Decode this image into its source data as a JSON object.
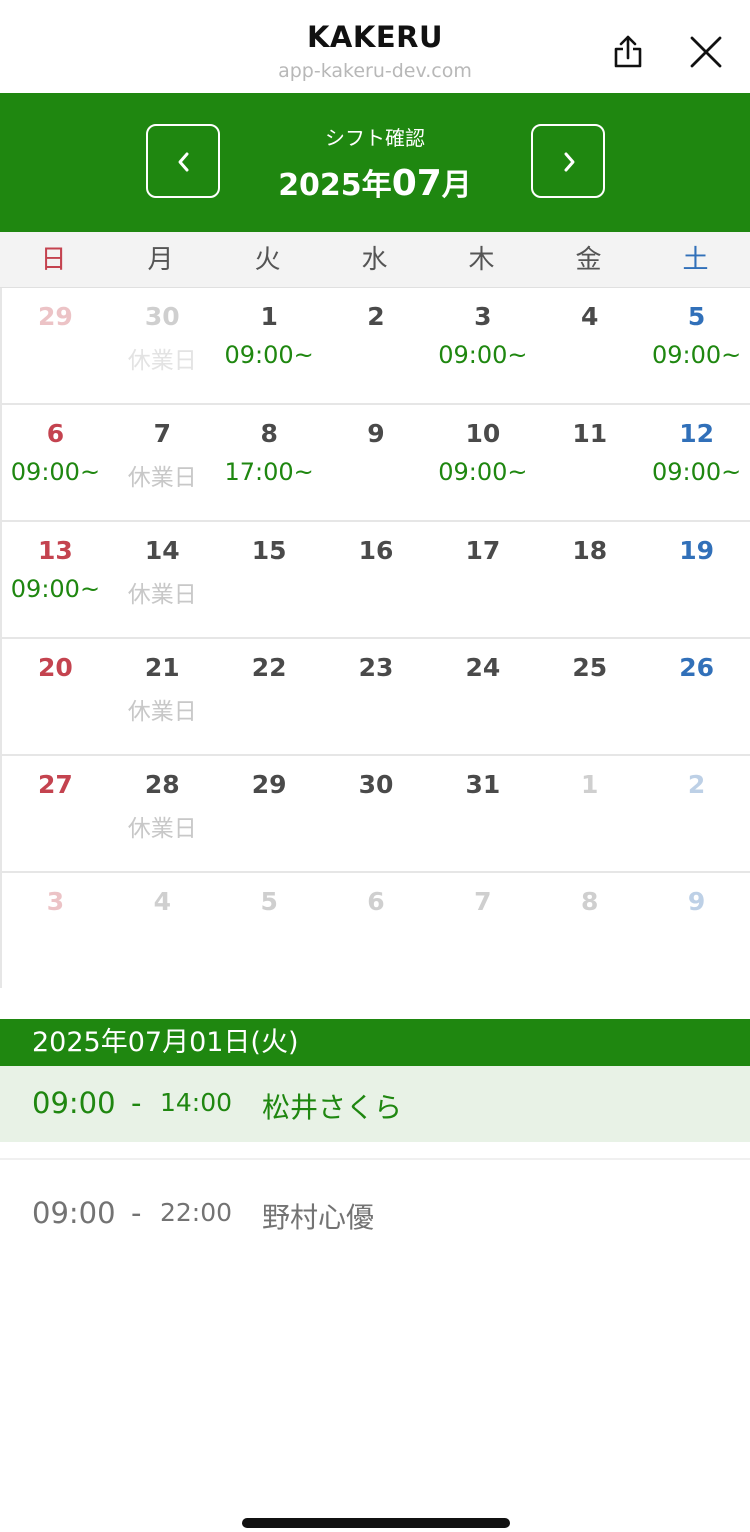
{
  "browser": {
    "title": "KAKERU",
    "url": "app-kakeru-dev.com"
  },
  "header": {
    "label": "シフト確認",
    "year_part": "2025年",
    "month_part": "07",
    "month_suffix": "月"
  },
  "weekdays": [
    "日",
    "月",
    "火",
    "水",
    "木",
    "金",
    "土"
  ],
  "weeks": [
    [
      {
        "day": "29",
        "shift": "",
        "other": true
      },
      {
        "day": "30",
        "shift": "休業日",
        "holiday": true,
        "other": true
      },
      {
        "day": "1",
        "shift": "09:00~"
      },
      {
        "day": "2",
        "shift": ""
      },
      {
        "day": "3",
        "shift": "09:00~"
      },
      {
        "day": "4",
        "shift": ""
      },
      {
        "day": "5",
        "shift": "09:00~"
      }
    ],
    [
      {
        "day": "6",
        "shift": "09:00~"
      },
      {
        "day": "7",
        "shift": "休業日",
        "holiday": true
      },
      {
        "day": "8",
        "shift": "17:00~"
      },
      {
        "day": "9",
        "shift": ""
      },
      {
        "day": "10",
        "shift": "09:00~"
      },
      {
        "day": "11",
        "shift": ""
      },
      {
        "day": "12",
        "shift": "09:00~"
      }
    ],
    [
      {
        "day": "13",
        "shift": "09:00~"
      },
      {
        "day": "14",
        "shift": "休業日",
        "holiday": true
      },
      {
        "day": "15",
        "shift": ""
      },
      {
        "day": "16",
        "shift": ""
      },
      {
        "day": "17",
        "shift": ""
      },
      {
        "day": "18",
        "shift": ""
      },
      {
        "day": "19",
        "shift": ""
      }
    ],
    [
      {
        "day": "20",
        "shift": ""
      },
      {
        "day": "21",
        "shift": "休業日",
        "holiday": true
      },
      {
        "day": "22",
        "shift": ""
      },
      {
        "day": "23",
        "shift": ""
      },
      {
        "day": "24",
        "shift": ""
      },
      {
        "day": "25",
        "shift": ""
      },
      {
        "day": "26",
        "shift": ""
      }
    ],
    [
      {
        "day": "27",
        "shift": ""
      },
      {
        "day": "28",
        "shift": "休業日",
        "holiday": true
      },
      {
        "day": "29",
        "shift": ""
      },
      {
        "day": "30",
        "shift": ""
      },
      {
        "day": "31",
        "shift": ""
      },
      {
        "day": "1",
        "shift": "",
        "other": true
      },
      {
        "day": "2",
        "shift": "",
        "other": true
      }
    ],
    [
      {
        "day": "3",
        "shift": "",
        "other": true
      },
      {
        "day": "4",
        "shift": "",
        "other": true
      },
      {
        "day": "5",
        "shift": "",
        "other": true
      },
      {
        "day": "6",
        "shift": "",
        "other": true
      },
      {
        "day": "7",
        "shift": "",
        "other": true
      },
      {
        "day": "8",
        "shift": "",
        "other": true
      },
      {
        "day": "9",
        "shift": "",
        "other": true
      }
    ]
  ],
  "detail": {
    "date": "2025年07月01日(火)",
    "shifts": [
      {
        "start": "09:00",
        "dash": "-",
        "end": "14:00",
        "name": "松井さくら"
      },
      {
        "start": "09:00",
        "dash": "-",
        "end": "22:00",
        "name": "野村心優"
      }
    ]
  },
  "colors": {
    "accent": "#1f8710",
    "sunday": "#c4434f",
    "saturday": "#3170b9",
    "active_row_bg": "#e8f2e6"
  },
  "icons": {
    "share": "share-icon",
    "close": "close-icon",
    "prev": "chevron-left-icon",
    "next": "chevron-right-icon"
  }
}
